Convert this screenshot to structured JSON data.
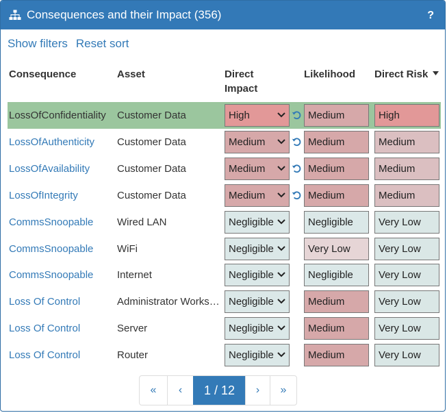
{
  "header": {
    "title": "Consequences and their Impact (356)",
    "help": "?"
  },
  "links": {
    "show_filters": "Show filters",
    "reset_sort": "Reset sort"
  },
  "columns": {
    "consequence": "Consequence",
    "asset": "Asset",
    "direct_impact_1": "Direct",
    "direct_impact_2": "Impact",
    "likelihood": "Likelihood",
    "direct_risk": "Direct Risk"
  },
  "colors": {
    "high": "#e29898",
    "medium": "#d6a8a9",
    "medium_light": "#dbbfc1",
    "very_low": "#dae7e6",
    "negligible": "#dbe8e8",
    "verylow_lik": "#e6d5d6"
  },
  "rows": [
    {
      "consequence": "LossOfConfidentiality",
      "asset": "Customer Data",
      "impact": "High",
      "likelihood": "Medium",
      "risk": "High",
      "selected": true,
      "reset": true,
      "impact_color": "#e29898",
      "lik_color": "#d6a8a9",
      "risk_color": "#e29898"
    },
    {
      "consequence": "LossOfAuthenticity",
      "asset": "Customer Data",
      "impact": "Medium",
      "likelihood": "Medium",
      "risk": "Medium",
      "reset": true,
      "impact_color": "#d6a8a9",
      "lik_color": "#d6a8a9",
      "risk_color": "#dbbfc1"
    },
    {
      "consequence": "LossOfAvailability",
      "asset": "Customer Data",
      "impact": "Medium",
      "likelihood": "Medium",
      "risk": "Medium",
      "reset": true,
      "impact_color": "#d6a8a9",
      "lik_color": "#d6a8a9",
      "risk_color": "#dbbfc1"
    },
    {
      "consequence": "LossOfIntegrity",
      "asset": "Customer Data",
      "impact": "Medium",
      "likelihood": "Medium",
      "risk": "Medium",
      "reset": true,
      "impact_color": "#d6a8a9",
      "lik_color": "#d6a8a9",
      "risk_color": "#dbbfc1"
    },
    {
      "consequence": "CommsSnoopable",
      "asset": "Wired LAN",
      "impact": "Negligible",
      "likelihood": "Negligible",
      "risk": "Very Low",
      "impact_color": "#dbe8e8",
      "lik_color": "#dbe8e8",
      "risk_color": "#dae7e6"
    },
    {
      "consequence": "CommsSnoopable",
      "asset": "WiFi",
      "impact": "Negligible",
      "likelihood": "Very Low",
      "risk": "Very Low",
      "impact_color": "#dbe8e8",
      "lik_color": "#e6d5d6",
      "risk_color": "#dae7e6"
    },
    {
      "consequence": "CommsSnoopable",
      "asset": "Internet",
      "impact": "Negligible",
      "likelihood": "Negligible",
      "risk": "Very Low",
      "impact_color": "#dbe8e8",
      "lik_color": "#dbe8e8",
      "risk_color": "#dae7e6"
    },
    {
      "consequence": "Loss Of Control",
      "asset": "Administrator Workstation",
      "impact": "Negligible",
      "likelihood": "Medium",
      "risk": "Very Low",
      "impact_color": "#dbe8e8",
      "lik_color": "#d6a8a9",
      "risk_color": "#dae7e6"
    },
    {
      "consequence": "Loss Of Control",
      "asset": "Server",
      "impact": "Negligible",
      "likelihood": "Medium",
      "risk": "Very Low",
      "impact_color": "#dbe8e8",
      "lik_color": "#d6a8a9",
      "risk_color": "#dae7e6"
    },
    {
      "consequence": "Loss Of Control",
      "asset": "Router",
      "impact": "Negligible",
      "likelihood": "Medium",
      "risk": "Very Low",
      "impact_color": "#dbe8e8",
      "lik_color": "#d6a8a9",
      "risk_color": "#dae7e6"
    }
  ],
  "pager": {
    "first": "«",
    "prev": "‹",
    "current": "1 / 12",
    "next": "›",
    "last": "»"
  }
}
